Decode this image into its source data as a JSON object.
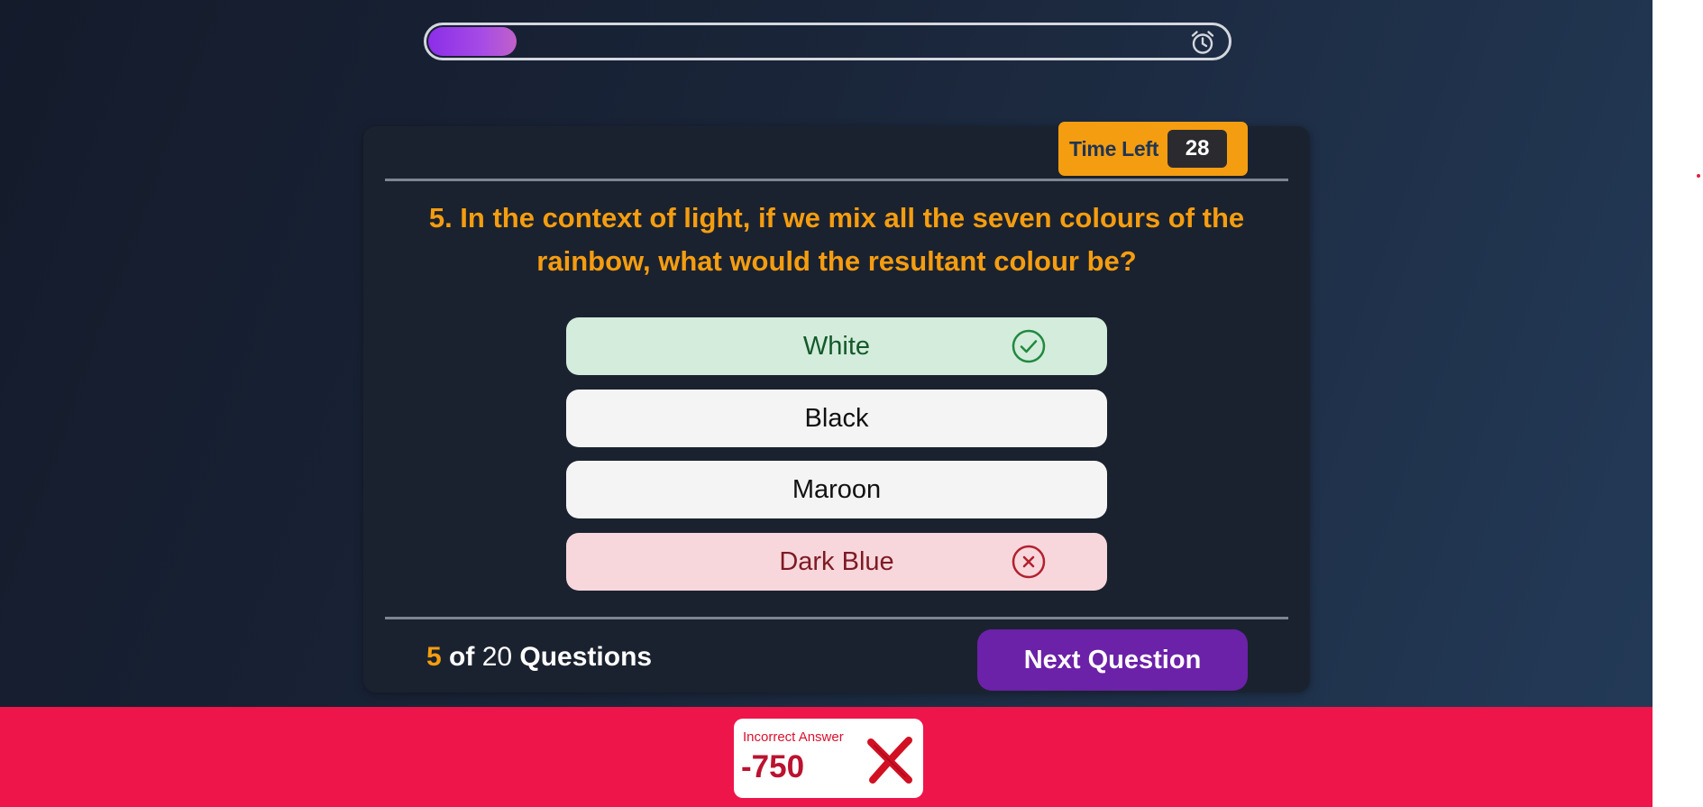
{
  "progress": {
    "value_fraction": 0.11
  },
  "timer": {
    "label": "Time Left",
    "value": "28"
  },
  "question": {
    "text": "5. In the context of light, if we mix all the seven colours of the rainbow, what would the resultant colour be?"
  },
  "options": [
    {
      "label": "White",
      "state": "correct"
    },
    {
      "label": "Black",
      "state": "neutral"
    },
    {
      "label": "Maroon",
      "state": "neutral"
    },
    {
      "label": "Dark Blue",
      "state": "incorrect"
    }
  ],
  "footer": {
    "current": "5",
    "of_text": " of ",
    "total": "20",
    "suffix": " Questions",
    "next_label": "Next Question"
  },
  "feedback": {
    "title": "Incorrect Answer",
    "score": "-750"
  },
  "colors": {
    "accent": "#f59d10",
    "button": "#6b21a8",
    "banner": "#ee154a",
    "correct_bg": "#d4ecdc",
    "incorrect_bg": "#f7d7db"
  },
  "icons": {
    "timer": "alarm-clock-icon",
    "correct": "check-circle-icon",
    "incorrect": "x-circle-icon",
    "feedback": "red-x-icon"
  }
}
